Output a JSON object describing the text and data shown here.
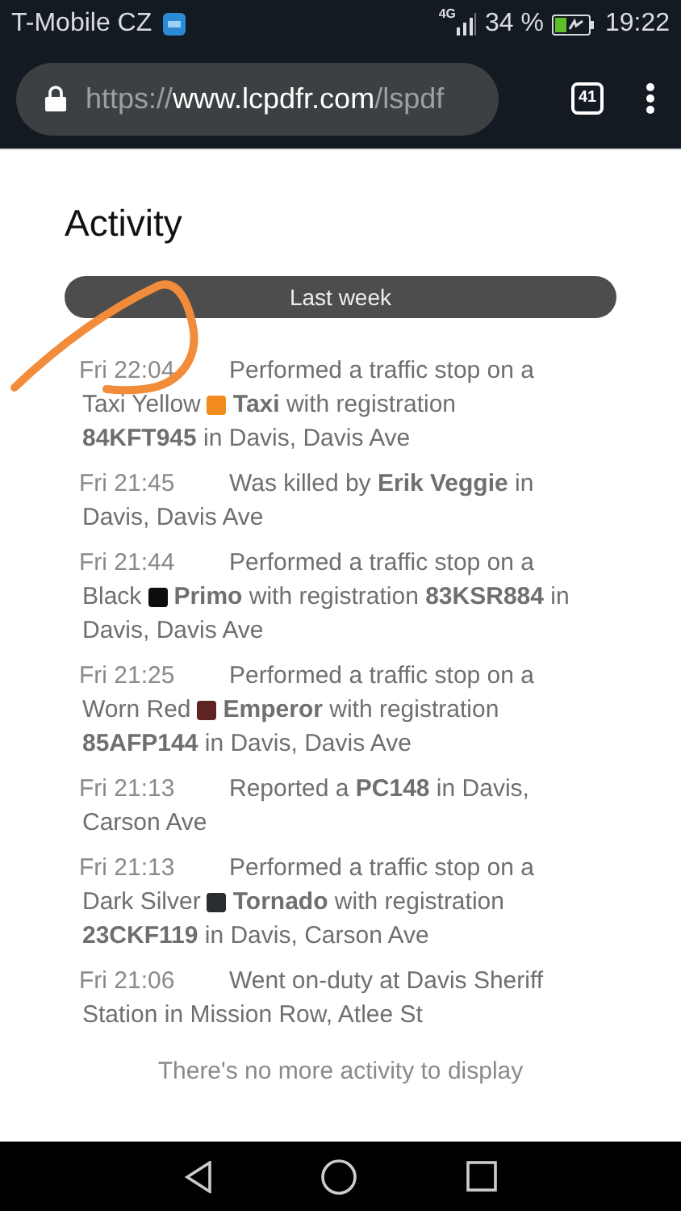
{
  "status_bar": {
    "carrier": "T-Mobile CZ",
    "network": "4G",
    "battery": "34 %",
    "time": "19:22"
  },
  "browser": {
    "url_scheme": "https://",
    "url_host": "www.lcpdfr.com",
    "url_path": "/lspdf",
    "tab_count": "41"
  },
  "page": {
    "title": "Activity",
    "filter": "Last week",
    "entries": [
      {
        "time": "Fri 22:04",
        "lines": [
          {
            "text": "Performed a traffic stop on a"
          },
          {
            "text": "Taxi Yellow",
            "color": "#f28b1e",
            "text_after": "**Taxi** with registration"
          },
          {
            "text": "**84KFT945** in Davis, Davis Ave"
          }
        ]
      },
      {
        "time": "Fri 21:45",
        "lines": [
          {
            "text": "Was killed by **Erik Veggie** in"
          },
          {
            "text": "Davis, Davis Ave"
          }
        ]
      },
      {
        "time": "Fri 21:44",
        "lines": [
          {
            "text": "Performed a traffic stop on a"
          },
          {
            "text": "Black",
            "color": "#0d0d0d",
            "text_after": "**Primo** with registration **83KSR884** in"
          },
          {
            "text": "Davis, Davis Ave"
          }
        ]
      },
      {
        "time": "Fri 21:25",
        "lines": [
          {
            "text": "Performed a traffic stop on a"
          },
          {
            "text": "Worn Red",
            "color": "#5e2424",
            "text_after": "**Emperor** with registration"
          },
          {
            "text": "**85AFP144** in Davis, Davis Ave"
          }
        ]
      },
      {
        "time": "Fri 21:13",
        "lines": [
          {
            "text": "Reported a **PC148** in Davis,"
          },
          {
            "text": "Carson Ave"
          }
        ]
      },
      {
        "time": "Fri 21:13",
        "lines": [
          {
            "text": "Performed a traffic stop on a"
          },
          {
            "text": "Dark Silver",
            "color": "#2b2e31",
            "text_after": "**Tornado** with registration"
          },
          {
            "text": "**23CKF119** in Davis, Carson Ave"
          }
        ]
      },
      {
        "time": "Fri 21:06",
        "lines": [
          {
            "text": "Went on-duty at Davis Sheriff"
          },
          {
            "text": "Station in Mission Row, Atlee St"
          }
        ]
      }
    ],
    "end_message": "There's no more activity to display"
  }
}
